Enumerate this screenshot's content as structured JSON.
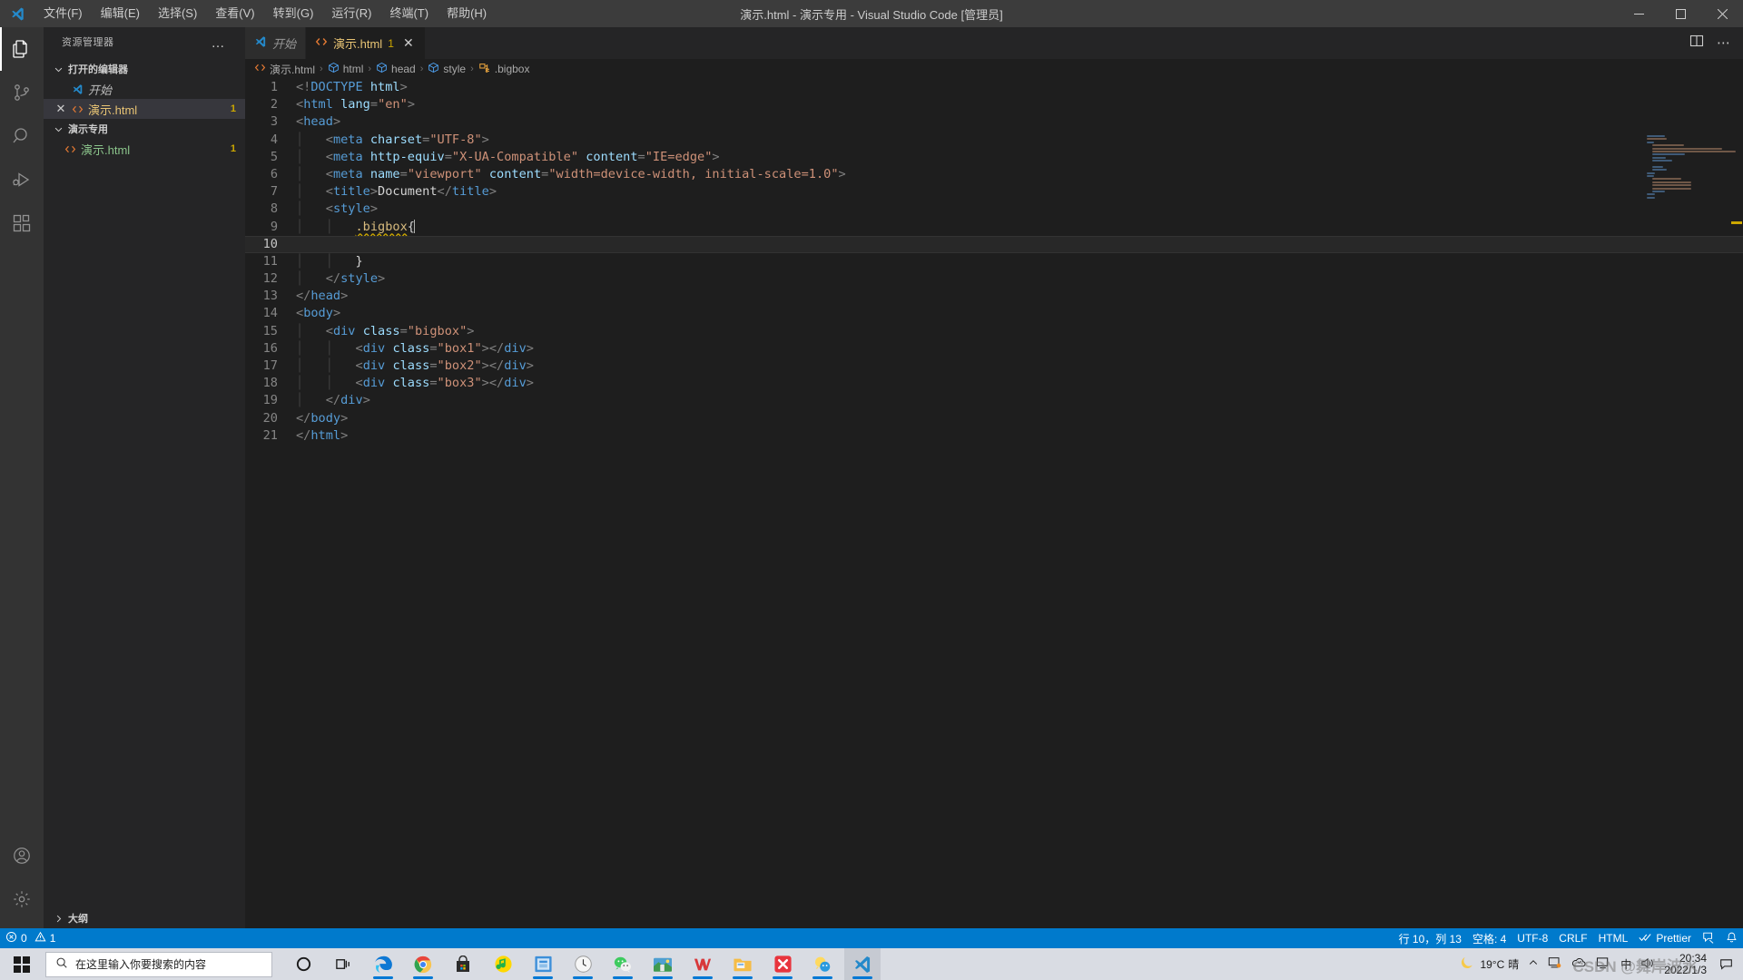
{
  "window": {
    "title": "演示.html - 演示专用 - Visual Studio Code [管理员]",
    "menu": [
      "文件(F)",
      "编辑(E)",
      "选择(S)",
      "查看(V)",
      "转到(G)",
      "运行(R)",
      "终端(T)",
      "帮助(H)"
    ],
    "controls": {
      "minimize": "—",
      "maximize": "□",
      "close": "✕"
    }
  },
  "activitybar": {
    "items": [
      {
        "name": "explorer",
        "icon": "files-icon",
        "active": true
      },
      {
        "name": "source-control",
        "icon": "source-control-icon",
        "active": false
      },
      {
        "name": "search",
        "icon": "search-icon",
        "active": false
      },
      {
        "name": "run-debug",
        "icon": "run-and-debug-icon",
        "active": false
      },
      {
        "name": "extensions",
        "icon": "extensions-icon",
        "active": false
      }
    ],
    "bottom": [
      {
        "name": "accounts",
        "icon": "account-icon"
      },
      {
        "name": "settings",
        "icon": "gear-icon"
      }
    ]
  },
  "sidebar": {
    "title": "资源管理器",
    "more_label": "…",
    "sections": [
      {
        "label": "打开的编辑器",
        "expanded": true
      },
      {
        "label": "演示专用",
        "expanded": true
      }
    ],
    "open_editors": [
      {
        "label": "开始",
        "icon": "vscode-icon",
        "italic": true,
        "close": "",
        "badge": "",
        "selected": false
      },
      {
        "label": "演示.html",
        "icon": "html-icon",
        "italic": false,
        "close": "✕",
        "badge": "1",
        "selected": true
      }
    ],
    "folder_files": [
      {
        "label": "演示.html",
        "icon": "html-icon",
        "badge": "1"
      }
    ],
    "outline_label": "大纲"
  },
  "editor": {
    "tabs": [
      {
        "label": "开始",
        "icon": "vscode-icon",
        "italic": true,
        "count": "",
        "close": "",
        "active": false
      },
      {
        "label": "演示.html",
        "icon": "html-icon",
        "italic": false,
        "count": "1",
        "close": "✕",
        "active": true
      }
    ],
    "tab_actions": [
      {
        "name": "split-editor-icon",
        "glyph": "▥"
      },
      {
        "name": "more-actions-icon",
        "glyph": "⋯"
      }
    ],
    "breadcrumb": [
      {
        "label": "演示.html",
        "icon": "html-icon"
      },
      {
        "label": "html",
        "icon": "symbol-module-icon"
      },
      {
        "label": "head",
        "icon": "symbol-module-icon"
      },
      {
        "label": "style",
        "icon": "symbol-module-icon"
      },
      {
        "label": ".bigbox",
        "icon": "symbol-ruleset-icon"
      }
    ],
    "breadcrumb_separator": "›",
    "active_line": 10,
    "cursor_line_col": "行 10，列 13",
    "lines": [
      {
        "n": 1,
        "tokens": [
          {
            "t": "punc",
            "v": "<!"
          },
          {
            "t": "tag",
            "v": "DOCTYPE"
          },
          {
            "t": "text",
            "v": " "
          },
          {
            "t": "attr",
            "v": "html"
          },
          {
            "t": "punc",
            "v": ">"
          }
        ]
      },
      {
        "n": 2,
        "tokens": [
          {
            "t": "punc",
            "v": "<"
          },
          {
            "t": "tag",
            "v": "html"
          },
          {
            "t": "text",
            "v": " "
          },
          {
            "t": "attr",
            "v": "lang"
          },
          {
            "t": "punc",
            "v": "="
          },
          {
            "t": "str",
            "v": "\"en\""
          },
          {
            "t": "punc",
            "v": ">"
          }
        ]
      },
      {
        "n": 3,
        "tokens": [
          {
            "t": "punc",
            "v": "<"
          },
          {
            "t": "tag",
            "v": "head"
          },
          {
            "t": "punc",
            "v": ">"
          }
        ]
      },
      {
        "n": 4,
        "tokens": [
          {
            "t": "guide",
            "v": "    "
          },
          {
            "t": "punc",
            "v": "<"
          },
          {
            "t": "tag",
            "v": "meta"
          },
          {
            "t": "text",
            "v": " "
          },
          {
            "t": "attr",
            "v": "charset"
          },
          {
            "t": "punc",
            "v": "="
          },
          {
            "t": "str",
            "v": "\"UTF-8\""
          },
          {
            "t": "punc",
            "v": ">"
          }
        ]
      },
      {
        "n": 5,
        "tokens": [
          {
            "t": "guide",
            "v": "    "
          },
          {
            "t": "punc",
            "v": "<"
          },
          {
            "t": "tag",
            "v": "meta"
          },
          {
            "t": "text",
            "v": " "
          },
          {
            "t": "attr",
            "v": "http-equiv"
          },
          {
            "t": "punc",
            "v": "="
          },
          {
            "t": "str",
            "v": "\"X-UA-Compatible\""
          },
          {
            "t": "text",
            "v": " "
          },
          {
            "t": "attr",
            "v": "content"
          },
          {
            "t": "punc",
            "v": "="
          },
          {
            "t": "str",
            "v": "\"IE=edge\""
          },
          {
            "t": "punc",
            "v": ">"
          }
        ]
      },
      {
        "n": 6,
        "tokens": [
          {
            "t": "guide",
            "v": "    "
          },
          {
            "t": "punc",
            "v": "<"
          },
          {
            "t": "tag",
            "v": "meta"
          },
          {
            "t": "text",
            "v": " "
          },
          {
            "t": "attr",
            "v": "name"
          },
          {
            "t": "punc",
            "v": "="
          },
          {
            "t": "str",
            "v": "\"viewport\""
          },
          {
            "t": "text",
            "v": " "
          },
          {
            "t": "attr",
            "v": "content"
          },
          {
            "t": "punc",
            "v": "="
          },
          {
            "t": "str",
            "v": "\"width=device-width, initial-scale=1.0\""
          },
          {
            "t": "punc",
            "v": ">"
          }
        ]
      },
      {
        "n": 7,
        "tokens": [
          {
            "t": "guide",
            "v": "    "
          },
          {
            "t": "punc",
            "v": "<"
          },
          {
            "t": "tag",
            "v": "title"
          },
          {
            "t": "punc",
            "v": ">"
          },
          {
            "t": "text",
            "v": "Document"
          },
          {
            "t": "punc",
            "v": "</"
          },
          {
            "t": "tag",
            "v": "title"
          },
          {
            "t": "punc",
            "v": ">"
          }
        ]
      },
      {
        "n": 8,
        "tokens": [
          {
            "t": "guide",
            "v": "    "
          },
          {
            "t": "punc",
            "v": "<"
          },
          {
            "t": "tag",
            "v": "style"
          },
          {
            "t": "punc",
            "v": ">"
          }
        ]
      },
      {
        "n": 9,
        "tokens": [
          {
            "t": "guide",
            "v": "    "
          },
          {
            "t": "guide",
            "v": "    "
          },
          {
            "t": "sel-squiggly",
            "v": ".bigbox"
          },
          {
            "t": "brace",
            "v": "{"
          },
          {
            "t": "cursor",
            "v": ""
          }
        ]
      },
      {
        "n": 10,
        "tokens": []
      },
      {
        "n": 11,
        "tokens": [
          {
            "t": "guide",
            "v": "    "
          },
          {
            "t": "guide",
            "v": "    "
          },
          {
            "t": "brace",
            "v": "}"
          }
        ]
      },
      {
        "n": 12,
        "tokens": [
          {
            "t": "guide",
            "v": "    "
          },
          {
            "t": "punc",
            "v": "</"
          },
          {
            "t": "tag",
            "v": "style"
          },
          {
            "t": "punc",
            "v": ">"
          }
        ]
      },
      {
        "n": 13,
        "tokens": [
          {
            "t": "punc",
            "v": "</"
          },
          {
            "t": "tag",
            "v": "head"
          },
          {
            "t": "punc",
            "v": ">"
          }
        ]
      },
      {
        "n": 14,
        "tokens": [
          {
            "t": "punc",
            "v": "<"
          },
          {
            "t": "tag",
            "v": "body"
          },
          {
            "t": "punc",
            "v": ">"
          }
        ]
      },
      {
        "n": 15,
        "tokens": [
          {
            "t": "guide",
            "v": "    "
          },
          {
            "t": "punc",
            "v": "<"
          },
          {
            "t": "tag",
            "v": "div"
          },
          {
            "t": "text",
            "v": " "
          },
          {
            "t": "attr",
            "v": "class"
          },
          {
            "t": "punc",
            "v": "="
          },
          {
            "t": "str",
            "v": "\"bigbox\""
          },
          {
            "t": "punc",
            "v": ">"
          }
        ]
      },
      {
        "n": 16,
        "tokens": [
          {
            "t": "guide",
            "v": "    "
          },
          {
            "t": "guide",
            "v": "    "
          },
          {
            "t": "punc",
            "v": "<"
          },
          {
            "t": "tag",
            "v": "div"
          },
          {
            "t": "text",
            "v": " "
          },
          {
            "t": "attr",
            "v": "class"
          },
          {
            "t": "punc",
            "v": "="
          },
          {
            "t": "str",
            "v": "\"box1\""
          },
          {
            "t": "punc",
            "v": "></"
          },
          {
            "t": "tag",
            "v": "div"
          },
          {
            "t": "punc",
            "v": ">"
          }
        ]
      },
      {
        "n": 17,
        "tokens": [
          {
            "t": "guide",
            "v": "    "
          },
          {
            "t": "guide",
            "v": "    "
          },
          {
            "t": "punc",
            "v": "<"
          },
          {
            "t": "tag",
            "v": "div"
          },
          {
            "t": "text",
            "v": " "
          },
          {
            "t": "attr",
            "v": "class"
          },
          {
            "t": "punc",
            "v": "="
          },
          {
            "t": "str",
            "v": "\"box2\""
          },
          {
            "t": "punc",
            "v": "></"
          },
          {
            "t": "tag",
            "v": "div"
          },
          {
            "t": "punc",
            "v": ">"
          }
        ]
      },
      {
        "n": 18,
        "tokens": [
          {
            "t": "guide",
            "v": "    "
          },
          {
            "t": "guide",
            "v": "    "
          },
          {
            "t": "punc",
            "v": "<"
          },
          {
            "t": "tag",
            "v": "div"
          },
          {
            "t": "text",
            "v": " "
          },
          {
            "t": "attr",
            "v": "class"
          },
          {
            "t": "punc",
            "v": "="
          },
          {
            "t": "str",
            "v": "\"box3\""
          },
          {
            "t": "punc",
            "v": "></"
          },
          {
            "t": "tag",
            "v": "div"
          },
          {
            "t": "punc",
            "v": ">"
          }
        ]
      },
      {
        "n": 19,
        "tokens": [
          {
            "t": "guide",
            "v": "    "
          },
          {
            "t": "punc",
            "v": "</"
          },
          {
            "t": "tag",
            "v": "div"
          },
          {
            "t": "punc",
            "v": ">"
          }
        ]
      },
      {
        "n": 20,
        "tokens": [
          {
            "t": "punc",
            "v": "</"
          },
          {
            "t": "tag",
            "v": "body"
          },
          {
            "t": "punc",
            "v": ">"
          }
        ]
      },
      {
        "n": 21,
        "tokens": [
          {
            "t": "punc",
            "v": "</"
          },
          {
            "t": "tag",
            "v": "html"
          },
          {
            "t": "punc",
            "v": ">"
          }
        ]
      }
    ]
  },
  "statusbar": {
    "left": [
      {
        "name": "problems",
        "icon": "error-icon",
        "errors": "0",
        "warn_icon": "warning-icon",
        "warnings": "1"
      }
    ],
    "errors": "0",
    "warnings": "1",
    "right": [
      {
        "name": "cursor-position",
        "label": "行 10，列 13"
      },
      {
        "name": "indentation",
        "label": "空格: 4"
      },
      {
        "name": "encoding",
        "label": "UTF-8"
      },
      {
        "name": "eol",
        "label": "CRLF"
      },
      {
        "name": "language-mode",
        "label": "HTML"
      },
      {
        "name": "prettier",
        "label": "Prettier",
        "icon": "double-check-icon"
      },
      {
        "name": "feedback",
        "label": "",
        "icon": "feedback-icon"
      },
      {
        "name": "notifications",
        "label": "",
        "icon": "bell-icon"
      }
    ]
  },
  "taskbar": {
    "start_label": "start-icon",
    "search_placeholder": "在这里输入你要搜索的内容",
    "apps": [
      {
        "name": "cortana",
        "icon": "cortana-icon",
        "running": false,
        "active": false
      },
      {
        "name": "task-view",
        "icon": "task-view-icon",
        "running": false,
        "active": false
      },
      {
        "name": "microsoft-edge",
        "icon": "edge-icon",
        "running": true,
        "active": false
      },
      {
        "name": "google-chrome",
        "icon": "chrome-icon",
        "running": true,
        "active": false
      },
      {
        "name": "microsoft-store",
        "icon": "store-icon",
        "running": false,
        "active": false
      },
      {
        "name": "qq-music",
        "icon": "qq-music-icon",
        "running": false,
        "active": false
      },
      {
        "name": "screen-recorder",
        "icon": "recorder-icon",
        "running": true,
        "active": false
      },
      {
        "name": "clock-app",
        "icon": "clock-app-icon",
        "running": true,
        "active": false
      },
      {
        "name": "wechat",
        "icon": "wechat-icon",
        "running": true,
        "active": false
      },
      {
        "name": "winrar",
        "icon": "winrar-icon",
        "running": true,
        "active": false
      },
      {
        "name": "wps-office",
        "icon": "wps-icon",
        "running": true,
        "active": false
      },
      {
        "name": "file-explorer",
        "icon": "folder-icon",
        "running": true,
        "active": false
      },
      {
        "name": "xmind",
        "icon": "xmind-icon",
        "running": true,
        "active": false
      },
      {
        "name": "qq",
        "icon": "qq-icon",
        "running": true,
        "active": false
      },
      {
        "name": "visual-studio-code",
        "icon": "vscode-icon",
        "running": true,
        "active": true
      }
    ],
    "tray": {
      "weather_icon": "moon-icon",
      "temperature": "19°C",
      "condition": "晴",
      "chevron": "︿",
      "icons": [
        "network-icon",
        "onedrive-icon",
        "display-icon",
        "ime-icon",
        "volume-icon"
      ],
      "ime_label": "中",
      "time": "20:34",
      "date": "2022/1/3",
      "notifications_icon": "notification-icon"
    },
    "watermark": "CSDN @舞岸波水"
  },
  "colors": {
    "accent": "#007acc",
    "titlebar": "#3c3c3c",
    "sidebar": "#252526",
    "editor": "#1e1e1e",
    "activitybar": "#333333",
    "warning": "#cca700",
    "tag": "#569cd6",
    "attr": "#9cdcfe",
    "string": "#ce9178",
    "selector": "#d7ba7d"
  }
}
